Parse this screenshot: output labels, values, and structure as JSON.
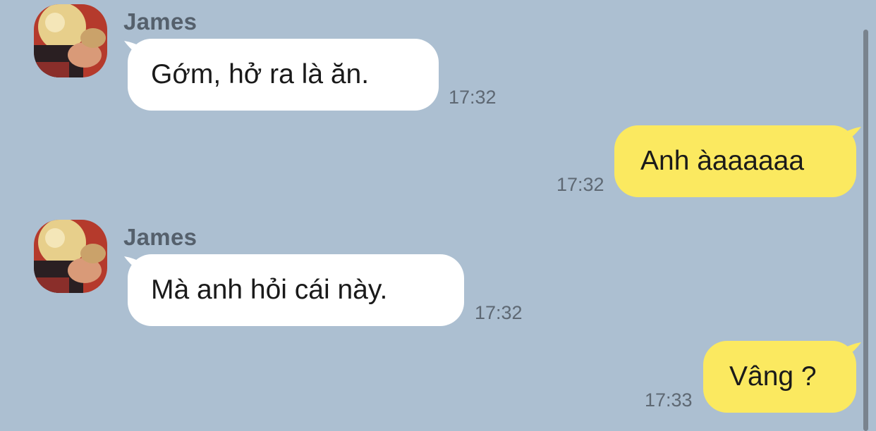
{
  "messages": [
    {
      "sender": "James",
      "text": "Gớm, hở ra là ăn.",
      "time": "17:32",
      "direction": "incoming"
    },
    {
      "text": "Anh àaaaaaa",
      "time": "17:32",
      "direction": "outgoing"
    },
    {
      "sender": "James",
      "text": "Mà anh hỏi cái này.",
      "time": "17:32",
      "direction": "incoming"
    },
    {
      "text": "Vâng ?",
      "time": "17:33",
      "direction": "outgoing"
    }
  ],
  "colors": {
    "background": "#acbfd1",
    "incoming_bubble": "#ffffff",
    "outgoing_bubble": "#fbe960",
    "sender_name": "#55606c",
    "timestamp": "#5e6873"
  }
}
